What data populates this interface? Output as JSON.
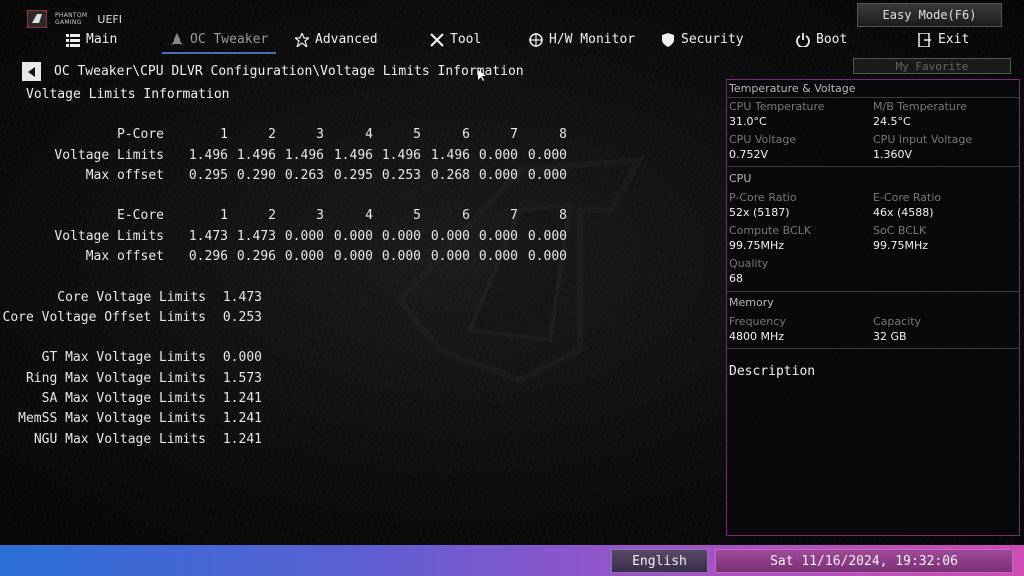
{
  "brand": {
    "line1": "PHANTOM",
    "line2": "GAMING",
    "uefi": "UEFI"
  },
  "easy_mode": "Easy Mode(F6)",
  "nav": [
    {
      "label": "Main",
      "icon": "list-icon"
    },
    {
      "label": "OC Tweaker",
      "icon": "rocket-icon",
      "active": true
    },
    {
      "label": "Advanced",
      "icon": "star-icon"
    },
    {
      "label": "Tool",
      "icon": "tools-icon"
    },
    {
      "label": "H/W Monitor",
      "icon": "crosshair-icon"
    },
    {
      "label": "Security",
      "icon": "shield-icon"
    },
    {
      "label": "Boot",
      "icon": "power-icon"
    },
    {
      "label": "Exit",
      "icon": "exit-icon"
    }
  ],
  "favorite": "My Favorite",
  "breadcrumb": "OC Tweaker\\CPU DLVR Configuration\\Voltage Limits Information",
  "page_title": "Voltage Limits Information",
  "pcore": {
    "label": "P-Core",
    "cols": [
      "1",
      "2",
      "3",
      "4",
      "5",
      "6",
      "7",
      "8"
    ],
    "rows": [
      {
        "label": "Voltage Limits",
        "values": [
          "1.496",
          "1.496",
          "1.496",
          "1.496",
          "1.496",
          "1.496",
          "0.000",
          "0.000"
        ]
      },
      {
        "label": "Max offset",
        "values": [
          "0.295",
          "0.290",
          "0.263",
          "0.295",
          "0.253",
          "0.268",
          "0.000",
          "0.000"
        ]
      }
    ]
  },
  "ecore": {
    "label": "E-Core",
    "cols": [
      "1",
      "2",
      "3",
      "4",
      "5",
      "6",
      "7",
      "8"
    ],
    "rows": [
      {
        "label": "Voltage Limits",
        "values": [
          "1.473",
          "1.473",
          "0.000",
          "0.000",
          "0.000",
          "0.000",
          "0.000",
          "0.000"
        ]
      },
      {
        "label": "Max offset",
        "values": [
          "0.296",
          "0.296",
          "0.000",
          "0.000",
          "0.000",
          "0.000",
          "0.000",
          "0.000"
        ]
      }
    ]
  },
  "core_limits": [
    {
      "label": "Core Voltage Limits",
      "value": "1.473"
    },
    {
      "label": "Core Voltage Offset Limits",
      "value": "0.253"
    }
  ],
  "other_limits": [
    {
      "label": "GT Max Voltage Limits",
      "value": "0.000"
    },
    {
      "label": "Ring Max Voltage Limits",
      "value": "1.573"
    },
    {
      "label": "SA Max Voltage Limits",
      "value": "1.241"
    },
    {
      "label": "MemSS Max Voltage Limits",
      "value": "1.241"
    },
    {
      "label": "NGU Max Voltage Limits",
      "value": "1.241"
    }
  ],
  "panel": {
    "temp_title": "Temperature & Voltage",
    "cpu_temp_label": "CPU Temperature",
    "cpu_temp": "31.0°C",
    "mb_temp_label": "M/B Temperature",
    "mb_temp": "24.5°C",
    "cpu_volt_label": "CPU Voltage",
    "cpu_volt": "0.752V",
    "cpu_in_volt_label": "CPU Input Voltage",
    "cpu_in_volt": "1.360V",
    "cpu_title": "CPU",
    "pcore_ratio_label": "P-Core Ratio",
    "pcore_ratio": "52x (5187)",
    "ecore_ratio_label": "E-Core Ratio",
    "ecore_ratio": "46x (4588)",
    "compute_bclk_label": "Compute BCLK",
    "compute_bclk": "99.75MHz",
    "soc_bclk_label": "SoC BCLK",
    "soc_bclk": "99.75MHz",
    "quality_label": "Quality",
    "quality": "68",
    "mem_title": "Memory",
    "freq_label": "Frequency",
    "freq": "4800 MHz",
    "cap_label": "Capacity",
    "cap": "32 GB",
    "desc_title": "Description"
  },
  "footer": {
    "language": "English",
    "datetime": "Sat 11/16/2024, 19:32:06"
  },
  "colors": {
    "accent": "#4a6fb0",
    "panel_border": "#7a2a7a",
    "footer_left": "#2a6fd6",
    "footer_right": "#d04cb4"
  }
}
